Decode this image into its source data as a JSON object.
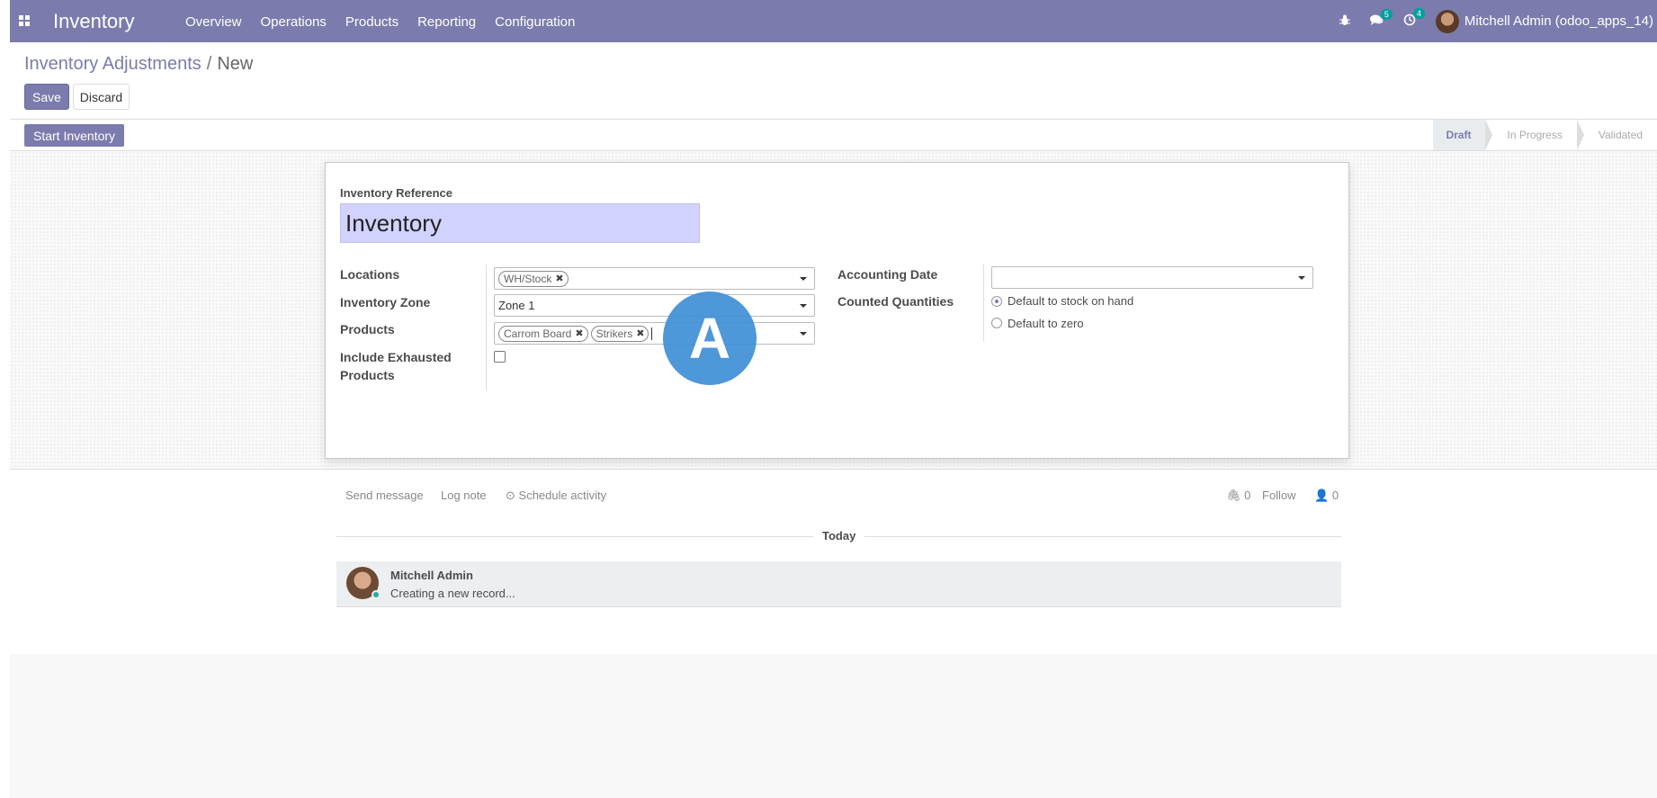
{
  "topbar": {
    "app_name": "Inventory",
    "menu": [
      "Overview",
      "Operations",
      "Products",
      "Reporting",
      "Configuration"
    ],
    "messages_count": "5",
    "activities_count": "4",
    "user_label": "Mitchell Admin (odoo_apps_14)"
  },
  "breadcrumb": {
    "parent": "Inventory Adjustments",
    "separator": "/",
    "current": "New"
  },
  "buttons": {
    "save": "Save",
    "discard": "Discard",
    "start_inventory": "Start Inventory"
  },
  "stages": [
    "Draft",
    "In Progress",
    "Validated"
  ],
  "form": {
    "ref_label": "Inventory Reference",
    "ref_value": "Inventory",
    "locations_label": "Locations",
    "locations_tags": [
      "WH/Stock"
    ],
    "zone_label": "Inventory Zone",
    "zone_value": "Zone 1",
    "products_label": "Products",
    "products_tags": [
      "Carrom Board",
      "Strikers"
    ],
    "exhausted_label_1": "Include Exhausted",
    "exhausted_label_2": "Products",
    "accounting_date_label": "Accounting Date",
    "accounting_date_value": "",
    "counted_label": "Counted Quantities",
    "counted_options": [
      "Default to stock on hand",
      "Default to zero"
    ],
    "counted_selected": "Default to stock on hand"
  },
  "marker_letter": "A",
  "chatter": {
    "send_message": "Send message",
    "log_note": "Log note",
    "schedule_activity": "Schedule activity",
    "attachments": "0",
    "follow": "Follow",
    "followers": "0",
    "today": "Today",
    "author": "Mitchell Admin",
    "body": "Creating a new record..."
  },
  "colors": {
    "brand": "#7c7bad",
    "badge": "#00a09d",
    "marker": "#3f8fd6",
    "ref_bg": "#d2d2ff"
  }
}
